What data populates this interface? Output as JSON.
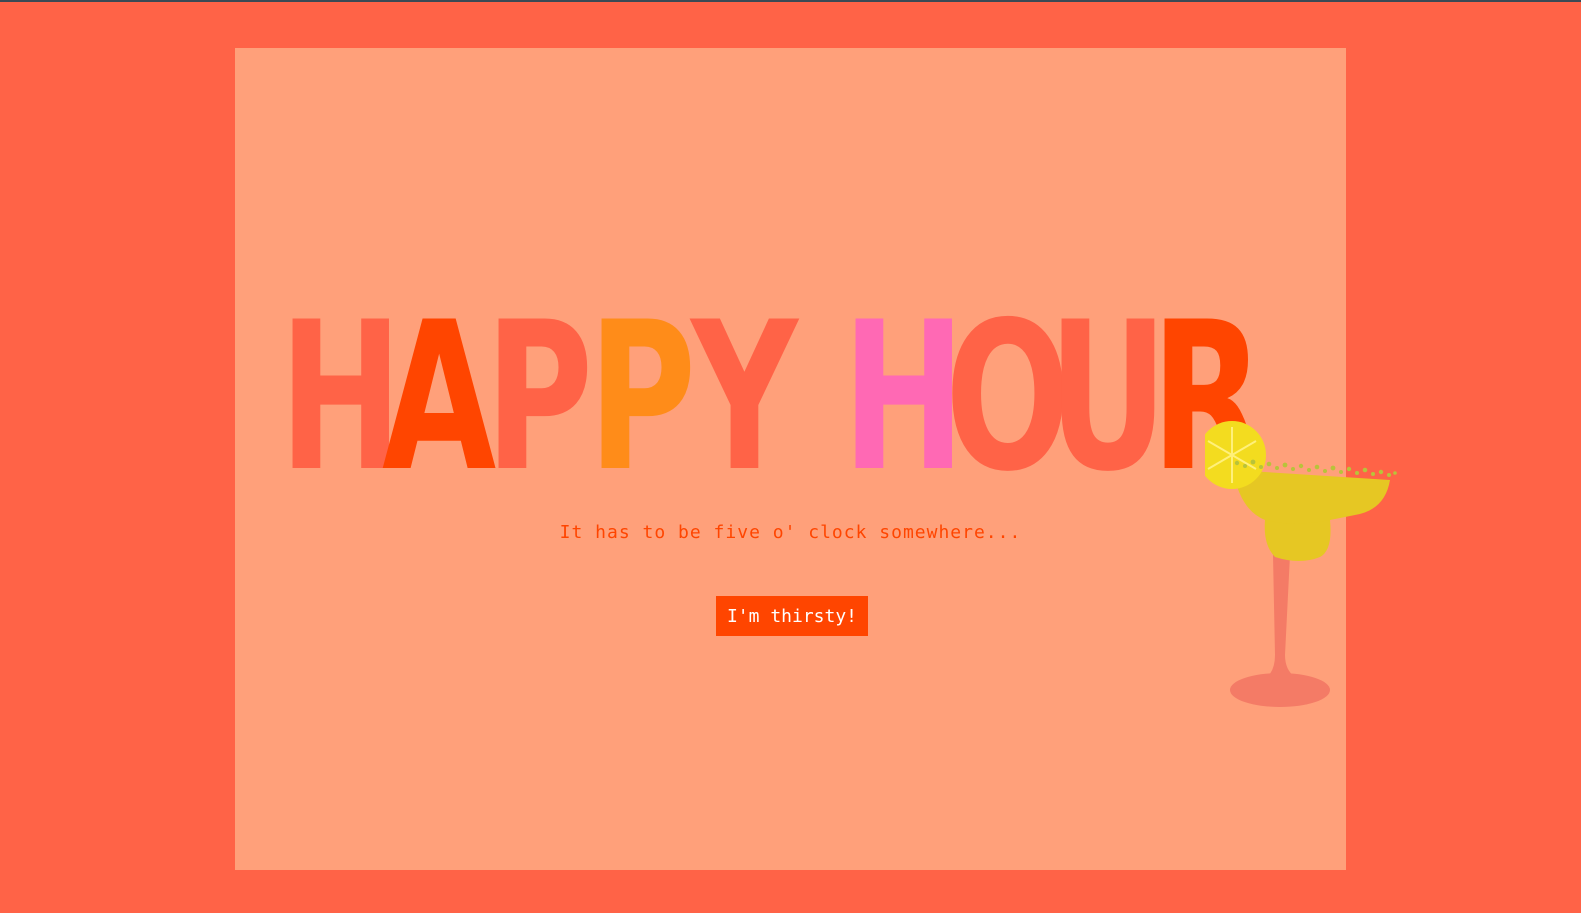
{
  "hero": {
    "title_word1": [
      "H",
      "A",
      "P",
      "P",
      "Y"
    ],
    "title_word2": [
      "H",
      "O",
      "U",
      "R"
    ],
    "tagline": "It has to be five o' clock somewhere...",
    "cta_label": "I'm thirsty!"
  },
  "colors": {
    "page_bg": "#ff6347",
    "card_bg": "#ffa07a",
    "tomato": "#ff6347",
    "orangered": "#ff4500",
    "orange": "#ff8c19",
    "pink": "#ff69b4",
    "lemon": "#e6c723",
    "glass_stem": "#f47b66"
  },
  "icons": {
    "drink": "margarita-glass-icon"
  }
}
